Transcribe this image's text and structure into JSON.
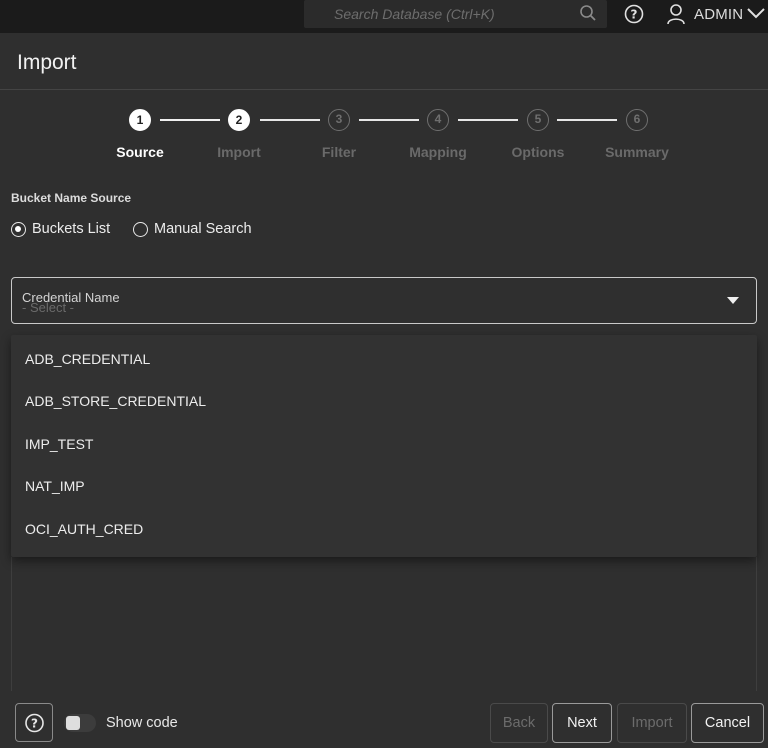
{
  "topbar": {
    "search_placeholder": "Search Database (Ctrl+K)",
    "user_label": "ADMIN"
  },
  "header": {
    "title": "Import"
  },
  "stepper": {
    "steps": [
      {
        "number": "1",
        "label": "Source",
        "state": "active"
      },
      {
        "number": "2",
        "label": "Import",
        "state": "done"
      },
      {
        "number": "3",
        "label": "Filter",
        "state": "todo"
      },
      {
        "number": "4",
        "label": "Mapping",
        "state": "todo"
      },
      {
        "number": "5",
        "label": "Options",
        "state": "todo"
      },
      {
        "number": "6",
        "label": "Summary",
        "state": "todo"
      }
    ]
  },
  "source": {
    "title": "Bucket Name Source",
    "options": [
      {
        "label": "Buckets List",
        "selected": true
      },
      {
        "label": "Manual Search",
        "selected": false
      }
    ]
  },
  "credential": {
    "label": "Credential Name",
    "placeholder": "- Select -",
    "options": [
      "ADB_CREDENTIAL",
      "ADB_STORE_CREDENTIAL",
      "IMP_TEST",
      "NAT_IMP",
      "OCI_AUTH_CRED"
    ]
  },
  "footer": {
    "show_code_label": "Show code",
    "show_code_on": false,
    "buttons": {
      "back": "Back",
      "next": "Next",
      "import": "Import",
      "cancel": "Cancel"
    }
  }
}
